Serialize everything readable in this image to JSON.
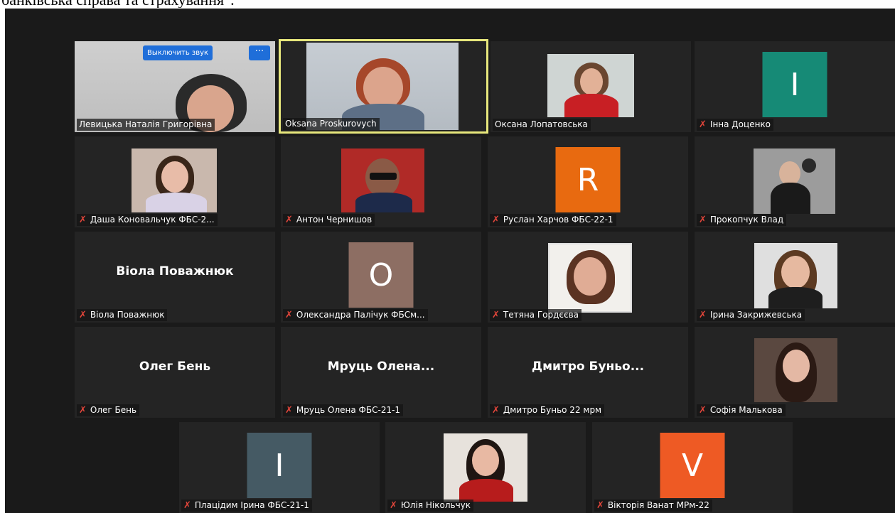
{
  "caption": "банківська справа та страхування\".",
  "host_controls": {
    "mute_label": "Выключить звук",
    "more_label": "···"
  },
  "colors": {
    "accent_speaker": "#e7e77c",
    "button_blue": "#1f6ed9",
    "muted_mic": "#e0453a",
    "tile_bg": "#242424"
  },
  "participants": [
    {
      "name": "Левицька Наталія Григорівна",
      "muted": false,
      "video": true
    },
    {
      "name": "Oksana Proskurovych",
      "muted": false,
      "video": true,
      "active_speaker": true
    },
    {
      "name": "Оксана Лопатовська",
      "muted": false,
      "video": true
    },
    {
      "name": "Інна Доценко",
      "muted": true,
      "avatar_letter": "I",
      "avatar_color": "#168a76"
    },
    {
      "name": "Даша Коновальчук ФБС-2...",
      "muted": true,
      "video": true
    },
    {
      "name": "Антон Чернишов",
      "muted": true,
      "video": true
    },
    {
      "name": "Руслан Харчов ФБС-22-1",
      "muted": true,
      "avatar_letter": "R",
      "avatar_color": "#e86a10"
    },
    {
      "name": "Прокопчук Влад",
      "muted": true,
      "video": true
    },
    {
      "name": "Віола Поважнюк",
      "muted": true,
      "display_name": "Віола Поважнюк"
    },
    {
      "name": "Олександра Палічук ФБСм...",
      "muted": true,
      "avatar_letter": "O",
      "avatar_color": "#8d6e63"
    },
    {
      "name": "Тетяна Гордєєва",
      "muted": true,
      "video": true
    },
    {
      "name": "Ірина Закрижевська",
      "muted": true,
      "video": true
    },
    {
      "name": "Олег Бень",
      "muted": true,
      "display_name": "Олег Бень"
    },
    {
      "name": "Мруць Олена ФБС-21-1",
      "muted": true,
      "display_name": "Мруць Олена..."
    },
    {
      "name": "Дмитро Буньо 22 мрм",
      "muted": true,
      "display_name": "Дмитро Буньо..."
    },
    {
      "name": "Софія Малькова",
      "muted": true,
      "video": true
    },
    {
      "name": "Плацідим Ірина ФБС-21-1",
      "muted": true,
      "avatar_letter": "I",
      "avatar_color": "#455a64"
    },
    {
      "name": "Юлія Нікольчук",
      "muted": true,
      "video": true
    },
    {
      "name": "Вікторія Ванат МРм-22",
      "muted": true,
      "avatar_letter": "V",
      "avatar_color": "#ee5a24"
    }
  ]
}
